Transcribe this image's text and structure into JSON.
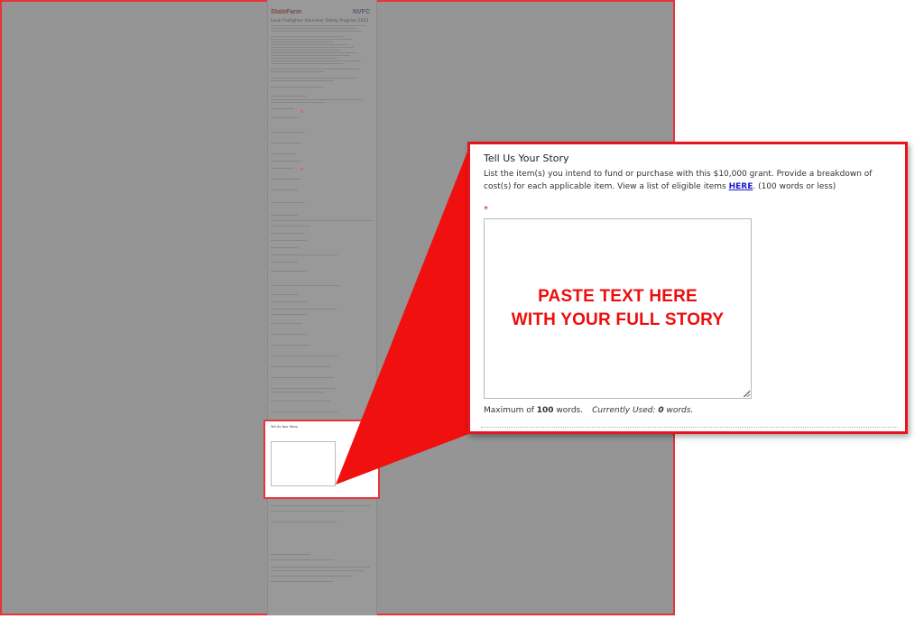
{
  "thumbnail": {
    "logo_left": "StateFarm",
    "logo_right": "NVFC",
    "title": "Local Firefighter Volunteer Safety Program 2023"
  },
  "callout": {
    "title": "Tell Us Your Story",
    "description_prefix": "List the item(s) you intend to fund or purchase with this $10,000 grant. Provide a breakdown of cost(s) for each applicable item. View a list of eligible items ",
    "link_text": "HERE",
    "description_suffix": ". (100 words or less)",
    "required_marker": "*",
    "textarea_value": "",
    "overlay_line1": "PASTE TEXT HERE",
    "overlay_line2": "WITH YOUR FULL STORY",
    "max_label": "Maximum of ",
    "max_words": "100",
    "max_suffix": " words.",
    "used_label": "Currently Used: ",
    "used_words": "0",
    "used_suffix": " words."
  },
  "colors": {
    "accent_red": "#e8131c",
    "overlay_text_red": "#ee0d0d",
    "link_blue": "#1a1acc",
    "dim_grey": "#959595"
  }
}
